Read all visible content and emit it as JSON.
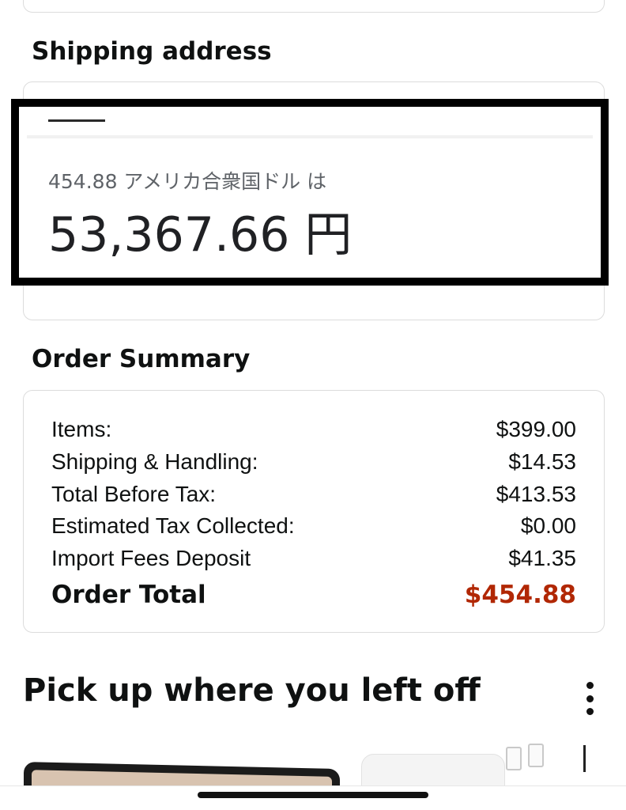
{
  "shipping": {
    "heading": "Shipping address"
  },
  "conversion": {
    "source": "454.88 アメリカ合衆国ドル は",
    "result": "53,367.66 円"
  },
  "order_summary": {
    "heading": "Order Summary",
    "rows": [
      {
        "label": "Items:",
        "value": "$399.00"
      },
      {
        "label": "Shipping & Handling:",
        "value": "$14.53"
      },
      {
        "label": "Total Before Tax:",
        "value": "$413.53"
      },
      {
        "label": "Estimated Tax Collected:",
        "value": "$0.00"
      },
      {
        "label": "Import Fees Deposit",
        "value": "$41.35"
      }
    ],
    "total_label": "Order Total",
    "total_value": "$454.88",
    "total_color": "#b12704"
  },
  "recommendations": {
    "heading": "Pick up where you left off",
    "more_icon": "more-vertical-icon",
    "items": [
      {
        "icon": "tablet-product-image"
      },
      {
        "icon": "charger-product-image"
      },
      {
        "icon": "cable-product-image"
      }
    ]
  }
}
